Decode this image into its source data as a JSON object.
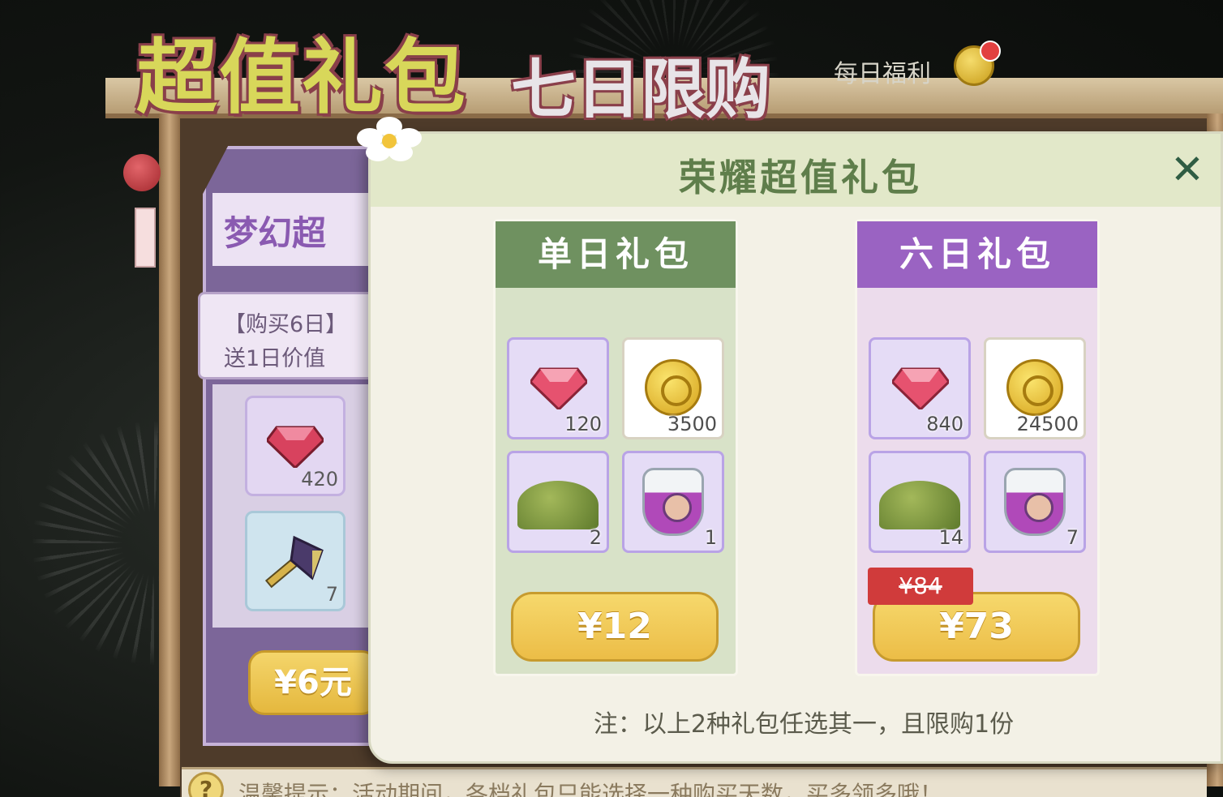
{
  "header": {
    "title_main": "超值礼包",
    "title_sub": "七日限购",
    "daily_label": "每日福利"
  },
  "left_panel": {
    "title": "梦幻超",
    "note_line1": "【购买6日】",
    "note_line2": "送1日价值",
    "items": [
      {
        "icon": "gem-icon",
        "qty": "420"
      },
      {
        "icon": "axe-icon",
        "qty": "7"
      }
    ],
    "buy_label": "¥6元"
  },
  "tips": {
    "icon": "?",
    "text": "温馨提示：活动期间，各档礼包只能选择一种购买天数，买多领多哦！"
  },
  "modal": {
    "title": "荣耀超值礼包",
    "close_label": "✕",
    "packages": [
      {
        "name": "单日礼包",
        "accent": "#6f9160",
        "items": [
          {
            "icon": "gem-icon",
            "qty": "120"
          },
          {
            "icon": "gold-coin-icon",
            "qty": "3500"
          },
          {
            "icon": "grass-pile-icon",
            "qty": "2"
          },
          {
            "icon": "potion-icon",
            "qty": "1"
          }
        ],
        "price": "¥12"
      },
      {
        "name": "六日礼包",
        "accent": "#9a63c2",
        "items": [
          {
            "icon": "gem-icon",
            "qty": "840"
          },
          {
            "icon": "gold-coin-icon",
            "qty": "24500"
          },
          {
            "icon": "grass-pile-icon",
            "qty": "14"
          },
          {
            "icon": "potion-icon",
            "qty": "7"
          }
        ],
        "old_price": "¥84",
        "price": "¥73"
      }
    ],
    "note": "注：以上2种礼包任选其一，且限购1份"
  }
}
